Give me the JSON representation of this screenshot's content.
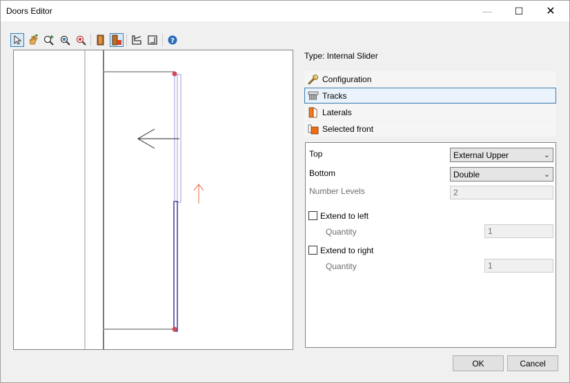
{
  "window": {
    "title": "Doors Editor"
  },
  "controls": {
    "minimize": "—",
    "maximize": "☐",
    "close": "✕"
  },
  "toolbar": {
    "items": [
      {
        "icon": "pointer-icon",
        "active": true
      },
      {
        "icon": "pan-hand-icon",
        "active": false
      },
      {
        "icon": "zoom-in-icon",
        "active": false
      },
      {
        "icon": "zoom-window-icon",
        "active": false
      },
      {
        "icon": "zoom-extents-icon",
        "active": false
      },
      {
        "icon": "door-front-icon",
        "active": false
      },
      {
        "icon": "door-lateral-icon",
        "active": true
      },
      {
        "icon": "view-left-icon",
        "active": false
      },
      {
        "icon": "view-right-icon",
        "active": false
      },
      {
        "icon": "help-icon",
        "active": false
      }
    ]
  },
  "type_label": "Type: Internal Slider",
  "sections": [
    {
      "label": "Configuration",
      "icon": "wrench-icon",
      "active": false
    },
    {
      "label": "Tracks",
      "icon": "tracks-icon",
      "active": true
    },
    {
      "label": "Laterals",
      "icon": "laterals-icon",
      "active": false
    },
    {
      "label": "Selected front",
      "icon": "front-icon",
      "active": false
    }
  ],
  "props": {
    "top_label": "Top",
    "top_value": "External Upper",
    "bottom_label": "Bottom",
    "bottom_value": "Double",
    "levels_label": "Number Levels",
    "levels_value": "2",
    "extend_left_label": "Extend to left",
    "extend_left_checked": false,
    "quantity_left_label": "Quantity",
    "quantity_left_value": "1",
    "extend_right_label": "Extend to right",
    "extend_right_checked": false,
    "quantity_right_label": "Quantity",
    "quantity_right_value": "1"
  },
  "buttons": {
    "ok": "OK",
    "cancel": "Cancel"
  },
  "colors": {
    "accent": "#3c7fb1",
    "track_blue": "#1a1a8c",
    "track_light": "#9a9ae0",
    "node_red": "#d04b5a",
    "arrow_orange": "#f08060"
  }
}
